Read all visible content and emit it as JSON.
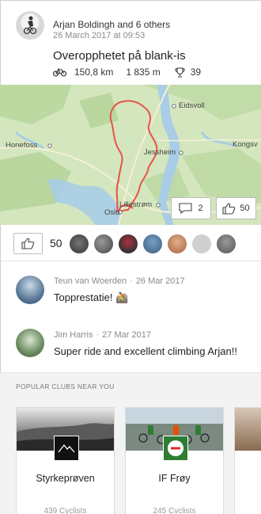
{
  "activity": {
    "athlete": "Arjan Boldingh and 6 others",
    "datetime": "26 March 2017 at 09:53",
    "title": "Overopphetet på blank-is",
    "distance": "150,8 km",
    "elevation": "1 835 m",
    "achievements": "39"
  },
  "map": {
    "labels": {
      "eidsvoll": "Eidsvoll",
      "honefoss": "Honefoss",
      "kongsvinger": "Kongsv",
      "jessheim": "Jessheim",
      "lillestrom": "Lillestrøm",
      "oslo": "Oslo"
    },
    "comments_count": "2",
    "kudos_count": "50"
  },
  "kudos": {
    "count": "50"
  },
  "comments": [
    {
      "author": "Teun van Woerden",
      "date": "26 Mar 2017",
      "text": "Topprestatie! 🚵"
    },
    {
      "author": "Jim Harris",
      "date": "27 Mar 2017",
      "text": "Super ride and excellent climbing Arjan!!"
    }
  ],
  "clubs": {
    "section_title": "POPULAR CLUBS NEAR YOU",
    "items": [
      {
        "name": "Styrkeprøven",
        "members": "439 Cyclists"
      },
      {
        "name": "IF Frøy",
        "members": "245 Cyclists"
      }
    ]
  },
  "colors": {
    "route": "#e8524a",
    "accent": "#fc4c02",
    "map_land": "#cfe3b8"
  }
}
